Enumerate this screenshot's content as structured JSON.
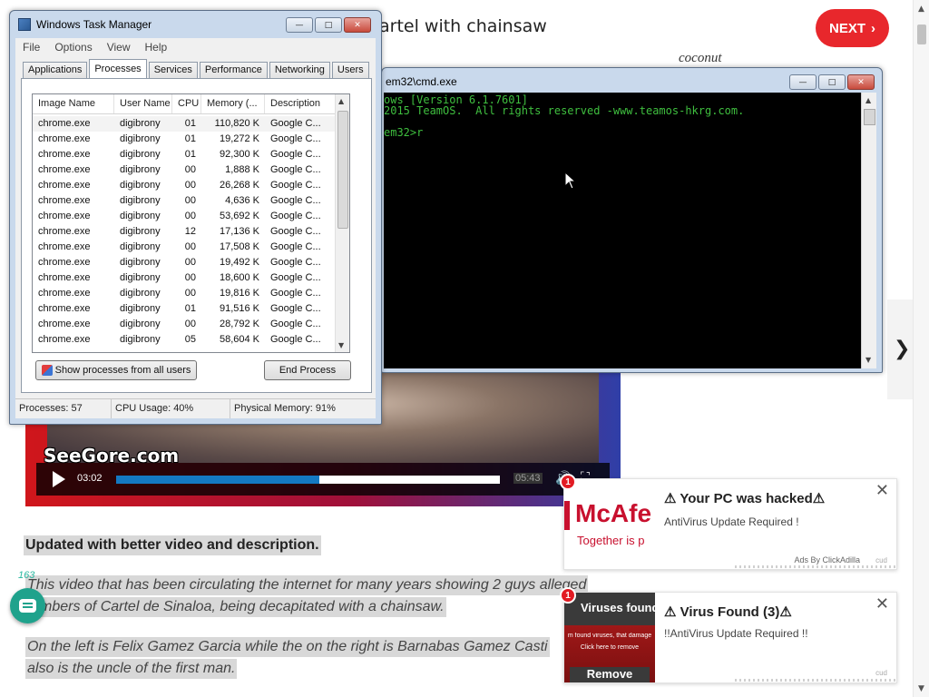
{
  "page": {
    "title_visible": "artel with chainsaw",
    "next_label": "NEXT",
    "side_text": "coconut",
    "right_arrow": "❯",
    "video": {
      "watermark": "SeeGore.com",
      "time_current": "03:02",
      "time_total": "05:43",
      "progress": 0.53
    },
    "lines": [
      "Updated with better video and description.",
      "This video that has been circulating the internet for many years showing 2 guys alleged",
      "mbers of Cartel de Sinaloa, being decapitated with a chainsaw.",
      "On the left is Felix Gamez Garcia while the on the right is Barnabas Gamez Casti",
      "also is the uncle of the first man."
    ],
    "comment_count": "163"
  },
  "ads": [
    {
      "title": "⚠ Your PC was hacked⚠",
      "subtitle": "AntiVirus Update Required !",
      "brand": "McAfe",
      "brand_sub": "Together is p",
      "by": "Ads By ClickAdilla",
      "cud": "cud",
      "badge": "1",
      "close": "✕"
    },
    {
      "title": "⚠ Virus Found (3)⚠",
      "subtitle": "!!AntiVirus Update Required !!",
      "thumb_title": "Viruses found",
      "thumb_text": "m found viruses, that damage",
      "thumb_click": "Click here to remove",
      "thumb_button": "Remove",
      "cud": "cud",
      "badge": "1",
      "close": "✕"
    }
  ],
  "task_manager": {
    "title": "Windows Task Manager",
    "menu": [
      "File",
      "Options",
      "View",
      "Help"
    ],
    "tabs": [
      "Applications",
      "Processes",
      "Services",
      "Performance",
      "Networking",
      "Users"
    ],
    "active_tab": "Processes",
    "columns": [
      "Image Name",
      "User Name",
      "CPU",
      "Memory (...",
      "Description"
    ],
    "rows": [
      [
        "chrome.exe",
        "digibrony",
        "01",
        "110,820 K",
        "Google C..."
      ],
      [
        "chrome.exe",
        "digibrony",
        "01",
        "19,272 K",
        "Google C..."
      ],
      [
        "chrome.exe",
        "digibrony",
        "01",
        "92,300 K",
        "Google C..."
      ],
      [
        "chrome.exe",
        "digibrony",
        "00",
        "1,888 K",
        "Google C..."
      ],
      [
        "chrome.exe",
        "digibrony",
        "00",
        "26,268 K",
        "Google C..."
      ],
      [
        "chrome.exe",
        "digibrony",
        "00",
        "4,636 K",
        "Google C..."
      ],
      [
        "chrome.exe",
        "digibrony",
        "00",
        "53,692 K",
        "Google C..."
      ],
      [
        "chrome.exe",
        "digibrony",
        "12",
        "17,136 K",
        "Google C..."
      ],
      [
        "chrome.exe",
        "digibrony",
        "00",
        "17,508 K",
        "Google C..."
      ],
      [
        "chrome.exe",
        "digibrony",
        "00",
        "19,492 K",
        "Google C..."
      ],
      [
        "chrome.exe",
        "digibrony",
        "00",
        "18,600 K",
        "Google C..."
      ],
      [
        "chrome.exe",
        "digibrony",
        "00",
        "19,816 K",
        "Google C..."
      ],
      [
        "chrome.exe",
        "digibrony",
        "01",
        "91,516 K",
        "Google C..."
      ],
      [
        "chrome.exe",
        "digibrony",
        "00",
        "28,792 K",
        "Google C..."
      ],
      [
        "chrome.exe",
        "digibrony",
        "05",
        "58,604 K",
        "Google C..."
      ]
    ],
    "show_all_label": "Show processes from all users",
    "end_process_label": "End Process",
    "status": {
      "processes": "Processes: 57",
      "cpu": "CPU Usage: 40%",
      "memory": "Physical Memory: 91%"
    }
  },
  "cmd": {
    "title": "em32\\cmd.exe",
    "lines": [
      "ows [Version 6.1.7601]",
      "2015 TeamOS.  All rights reserved -www.teamos-hkrg.com.",
      "",
      "em32>r"
    ]
  },
  "window_buttons": {
    "minimize": "—",
    "maximize": "□",
    "close": "✕"
  },
  "colors": {
    "next_red": "#e8272c",
    "cmd_text": "#3fbf3f",
    "progress_blue": "#1479c2",
    "chat_green": "#1fa28c"
  }
}
